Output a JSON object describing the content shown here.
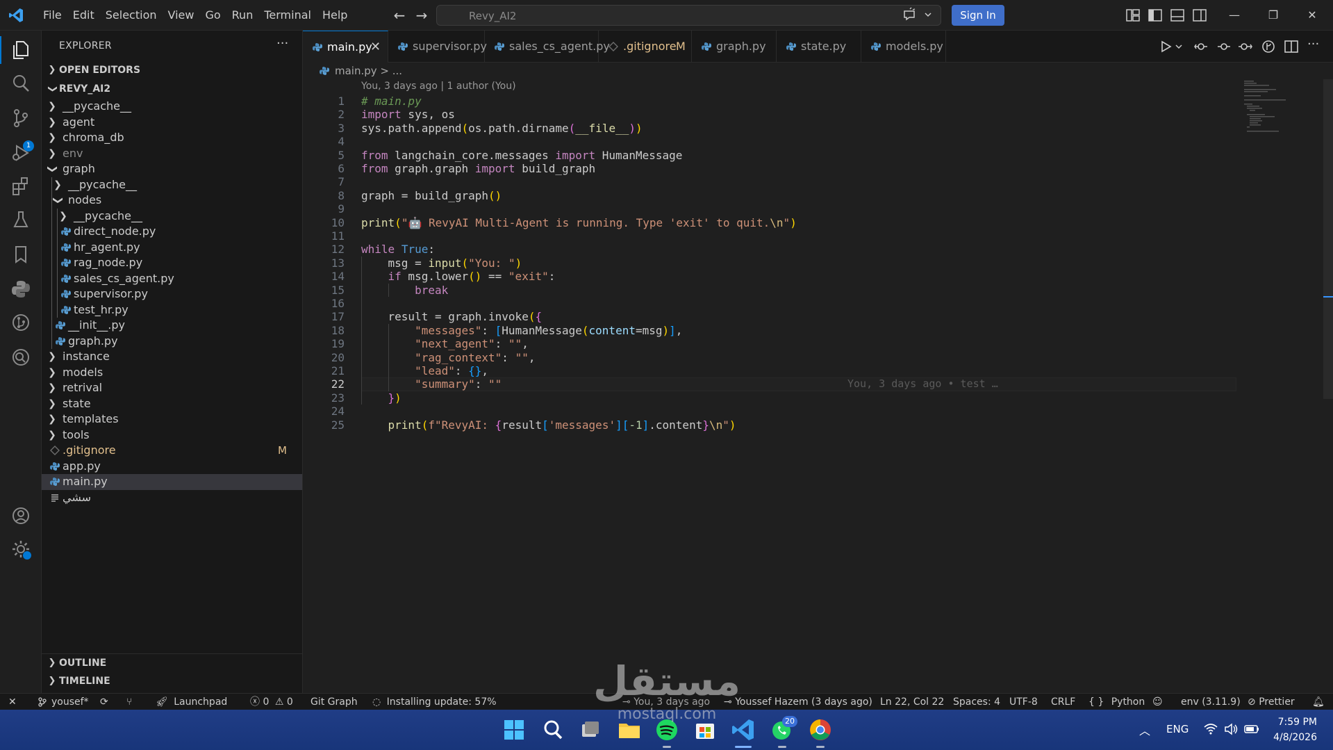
{
  "menu": [
    "File",
    "Edit",
    "Selection",
    "View",
    "Go",
    "Run",
    "Terminal",
    "Help"
  ],
  "command_center": {
    "text": "Revy_AI2"
  },
  "sign_in_label": "Sign In",
  "sidebar": {
    "title": "EXPLORER",
    "more": "···",
    "open_editors": "OPEN EDITORS",
    "project": "REVY_AI2",
    "outline": "OUTLINE",
    "timeline": "TIMELINE",
    "tree": [
      {
        "name": "__pycache__",
        "type": "folder",
        "expanded": false,
        "depth": 0
      },
      {
        "name": "agent",
        "type": "folder",
        "expanded": false,
        "depth": 0
      },
      {
        "name": "chroma_db",
        "type": "folder",
        "expanded": false,
        "depth": 0
      },
      {
        "name": "env",
        "type": "folder",
        "expanded": false,
        "depth": 0,
        "dim": true
      },
      {
        "name": "graph",
        "type": "folder",
        "expanded": true,
        "depth": 0
      },
      {
        "name": "__pycache__",
        "type": "folder",
        "expanded": false,
        "depth": 1
      },
      {
        "name": "nodes",
        "type": "folder",
        "expanded": true,
        "depth": 1
      },
      {
        "name": "__pycache__",
        "type": "folder",
        "expanded": false,
        "depth": 2
      },
      {
        "name": "direct_node.py",
        "type": "py",
        "depth": 2
      },
      {
        "name": "hr_agent.py",
        "type": "py",
        "depth": 2
      },
      {
        "name": "rag_node.py",
        "type": "py",
        "depth": 2
      },
      {
        "name": "sales_cs_agent.py",
        "type": "py",
        "depth": 2
      },
      {
        "name": "supervisor.py",
        "type": "py",
        "depth": 2
      },
      {
        "name": "test_hr.py",
        "type": "py",
        "depth": 2
      },
      {
        "name": "__init__.py",
        "type": "py",
        "depth": 1
      },
      {
        "name": "graph.py",
        "type": "py",
        "depth": 1
      },
      {
        "name": "instance",
        "type": "folder",
        "expanded": false,
        "depth": 0
      },
      {
        "name": "models",
        "type": "folder",
        "expanded": false,
        "depth": 0
      },
      {
        "name": "retrival",
        "type": "folder",
        "expanded": false,
        "depth": 0
      },
      {
        "name": "state",
        "type": "folder",
        "expanded": false,
        "depth": 0
      },
      {
        "name": "templates",
        "type": "folder",
        "expanded": false,
        "depth": 0
      },
      {
        "name": "tools",
        "type": "folder",
        "expanded": false,
        "depth": 0
      },
      {
        "name": ".gitignore",
        "type": "git",
        "depth": 0,
        "git_status": "M"
      },
      {
        "name": "app.py",
        "type": "py",
        "depth": 0
      },
      {
        "name": "main.py",
        "type": "py",
        "depth": 0,
        "selected": true
      },
      {
        "name": "سشي",
        "type": "txt",
        "depth": 0
      }
    ]
  },
  "tabs": [
    {
      "name": "main.py",
      "active": true,
      "icon": "python-icon"
    },
    {
      "name": "supervisor.py",
      "icon": "python-icon"
    },
    {
      "name": "sales_cs_agent.py",
      "icon": "python-icon"
    },
    {
      "name": ".gitignore",
      "icon": "git-icon",
      "status": "M"
    },
    {
      "name": "graph.py",
      "icon": "python-icon"
    },
    {
      "name": "state.py",
      "icon": "python-icon"
    },
    {
      "name": "models.py",
      "icon": "python-icon"
    }
  ],
  "breadcrumb": "main.py > ...",
  "codelens": "You, 3 days ago | 1 author (You)",
  "blame_inline": "You, 3 days ago • test …",
  "code_lines": [
    [
      [
        "cm",
        "# main.py"
      ]
    ],
    [
      [
        "kw",
        "import"
      ],
      [
        "",
        " sys, os"
      ]
    ],
    [
      [
        "",
        "sys.path.append"
      ],
      [
        "b1",
        "("
      ],
      [
        "",
        "os.path.dirname"
      ],
      [
        "b2",
        "("
      ],
      [
        "fn",
        "__file__"
      ],
      [
        "b2",
        ")"
      ],
      [
        "b1",
        ")"
      ]
    ],
    [],
    [
      [
        "kw",
        "from"
      ],
      [
        "",
        " langchain_core.messages "
      ],
      [
        "kw",
        "import"
      ],
      [
        "",
        " HumanMessage"
      ]
    ],
    [
      [
        "kw",
        "from"
      ],
      [
        "",
        " graph.graph "
      ],
      [
        "kw",
        "import"
      ],
      [
        "",
        " build_graph"
      ]
    ],
    [],
    [
      [
        "",
        "graph = build_graph"
      ],
      [
        "b1",
        "()"
      ]
    ],
    [],
    [
      [
        "bi",
        "print"
      ],
      [
        "b1",
        "("
      ],
      [
        "st",
        "\"🤖 RevyAI Multi-Agent is running. Type 'exit' to quit."
      ],
      [
        "es",
        "\\n"
      ],
      [
        "st",
        "\""
      ],
      [
        "b1",
        ")"
      ]
    ],
    [],
    [
      [
        "kw",
        "while"
      ],
      [
        "",
        " "
      ],
      [
        "co",
        "True"
      ],
      [
        "",
        ":"
      ]
    ],
    [
      [
        "",
        "    msg = "
      ],
      [
        "bi",
        "input"
      ],
      [
        "b1",
        "("
      ],
      [
        "st",
        "\"You: \""
      ],
      [
        "b1",
        ")"
      ]
    ],
    [
      [
        "",
        "    "
      ],
      [
        "kw",
        "if"
      ],
      [
        "",
        " msg.lower"
      ],
      [
        "b1",
        "()"
      ],
      [
        "",
        " == "
      ],
      [
        "st",
        "\"exit\""
      ],
      [
        "",
        ":"
      ]
    ],
    [
      [
        "",
        "        "
      ],
      [
        "kw",
        "break"
      ]
    ],
    [],
    [
      [
        "",
        "    result = graph.invoke"
      ],
      [
        "b1",
        "("
      ],
      [
        "b2",
        "{"
      ]
    ],
    [
      [
        "",
        "        "
      ],
      [
        "st",
        "\"messages\""
      ],
      [
        "",
        ": "
      ],
      [
        "b3",
        "["
      ],
      [
        "",
        "HumanMessage"
      ],
      [
        "b1",
        "("
      ],
      [
        "pa",
        "content"
      ],
      [
        "",
        "=msg"
      ],
      [
        "b1",
        ")"
      ],
      [
        "b3",
        "]"
      ],
      [
        "",
        ","
      ]
    ],
    [
      [
        "",
        "        "
      ],
      [
        "st",
        "\"next_agent\""
      ],
      [
        "",
        ": "
      ],
      [
        "st",
        "\"\""
      ],
      [
        "",
        ","
      ]
    ],
    [
      [
        "",
        "        "
      ],
      [
        "st",
        "\"rag_context\""
      ],
      [
        "",
        ": "
      ],
      [
        "st",
        "\"\""
      ],
      [
        "",
        ","
      ]
    ],
    [
      [
        "",
        "        "
      ],
      [
        "st",
        "\"lead\""
      ],
      [
        "",
        ": "
      ],
      [
        "b3",
        "{}"
      ],
      [
        "",
        ","
      ]
    ],
    [
      [
        "",
        "        "
      ],
      [
        "st",
        "\"summary\""
      ],
      [
        "",
        ": "
      ],
      [
        "st",
        "\"\""
      ]
    ],
    [
      [
        "",
        "    "
      ],
      [
        "b2",
        "}"
      ],
      [
        "b1",
        ")"
      ]
    ],
    [],
    [
      [
        "",
        "    "
      ],
      [
        "bi",
        "print"
      ],
      [
        "b1",
        "("
      ],
      [
        "st",
        "f\"RevyAI: "
      ],
      [
        "b2",
        "{"
      ],
      [
        "",
        "result"
      ],
      [
        "b3",
        "["
      ],
      [
        "st",
        "'messages'"
      ],
      [
        "b3",
        "]"
      ],
      [
        "b3",
        "["
      ],
      [
        "nu",
        "-1"
      ],
      [
        "b3",
        "]"
      ],
      [
        "",
        ".content"
      ],
      [
        "b2",
        "}"
      ],
      [
        "es",
        "\\n"
      ],
      [
        "st",
        "\""
      ],
      [
        "b1",
        ")"
      ]
    ]
  ],
  "current_line": 22,
  "statusbar": {
    "branch": "yousef*",
    "launchpad": "Launchpad",
    "errors": "0",
    "warnings": "0",
    "git_graph": "Git Graph",
    "update": "Installing update: 57%",
    "blame": "You, 3 days ago",
    "author": "Youssef Hazem (3 days ago)",
    "position": "Ln 22, Col 22",
    "spaces": "Spaces: 4",
    "encoding": "UTF-8",
    "eol": "CRLF",
    "language": "Python",
    "env": "env (3.11.9)",
    "prettier": "Prettier"
  },
  "taskbar": {
    "lang": "ENG",
    "time": "7:59 PM",
    "date": "4/8/2026",
    "whatsapp_badge": "20"
  },
  "source_control_badge": "1",
  "colors": {
    "accent": "#0078d4",
    "sign_in": "#3f6ec9",
    "taskbar": "#1e3c84"
  }
}
